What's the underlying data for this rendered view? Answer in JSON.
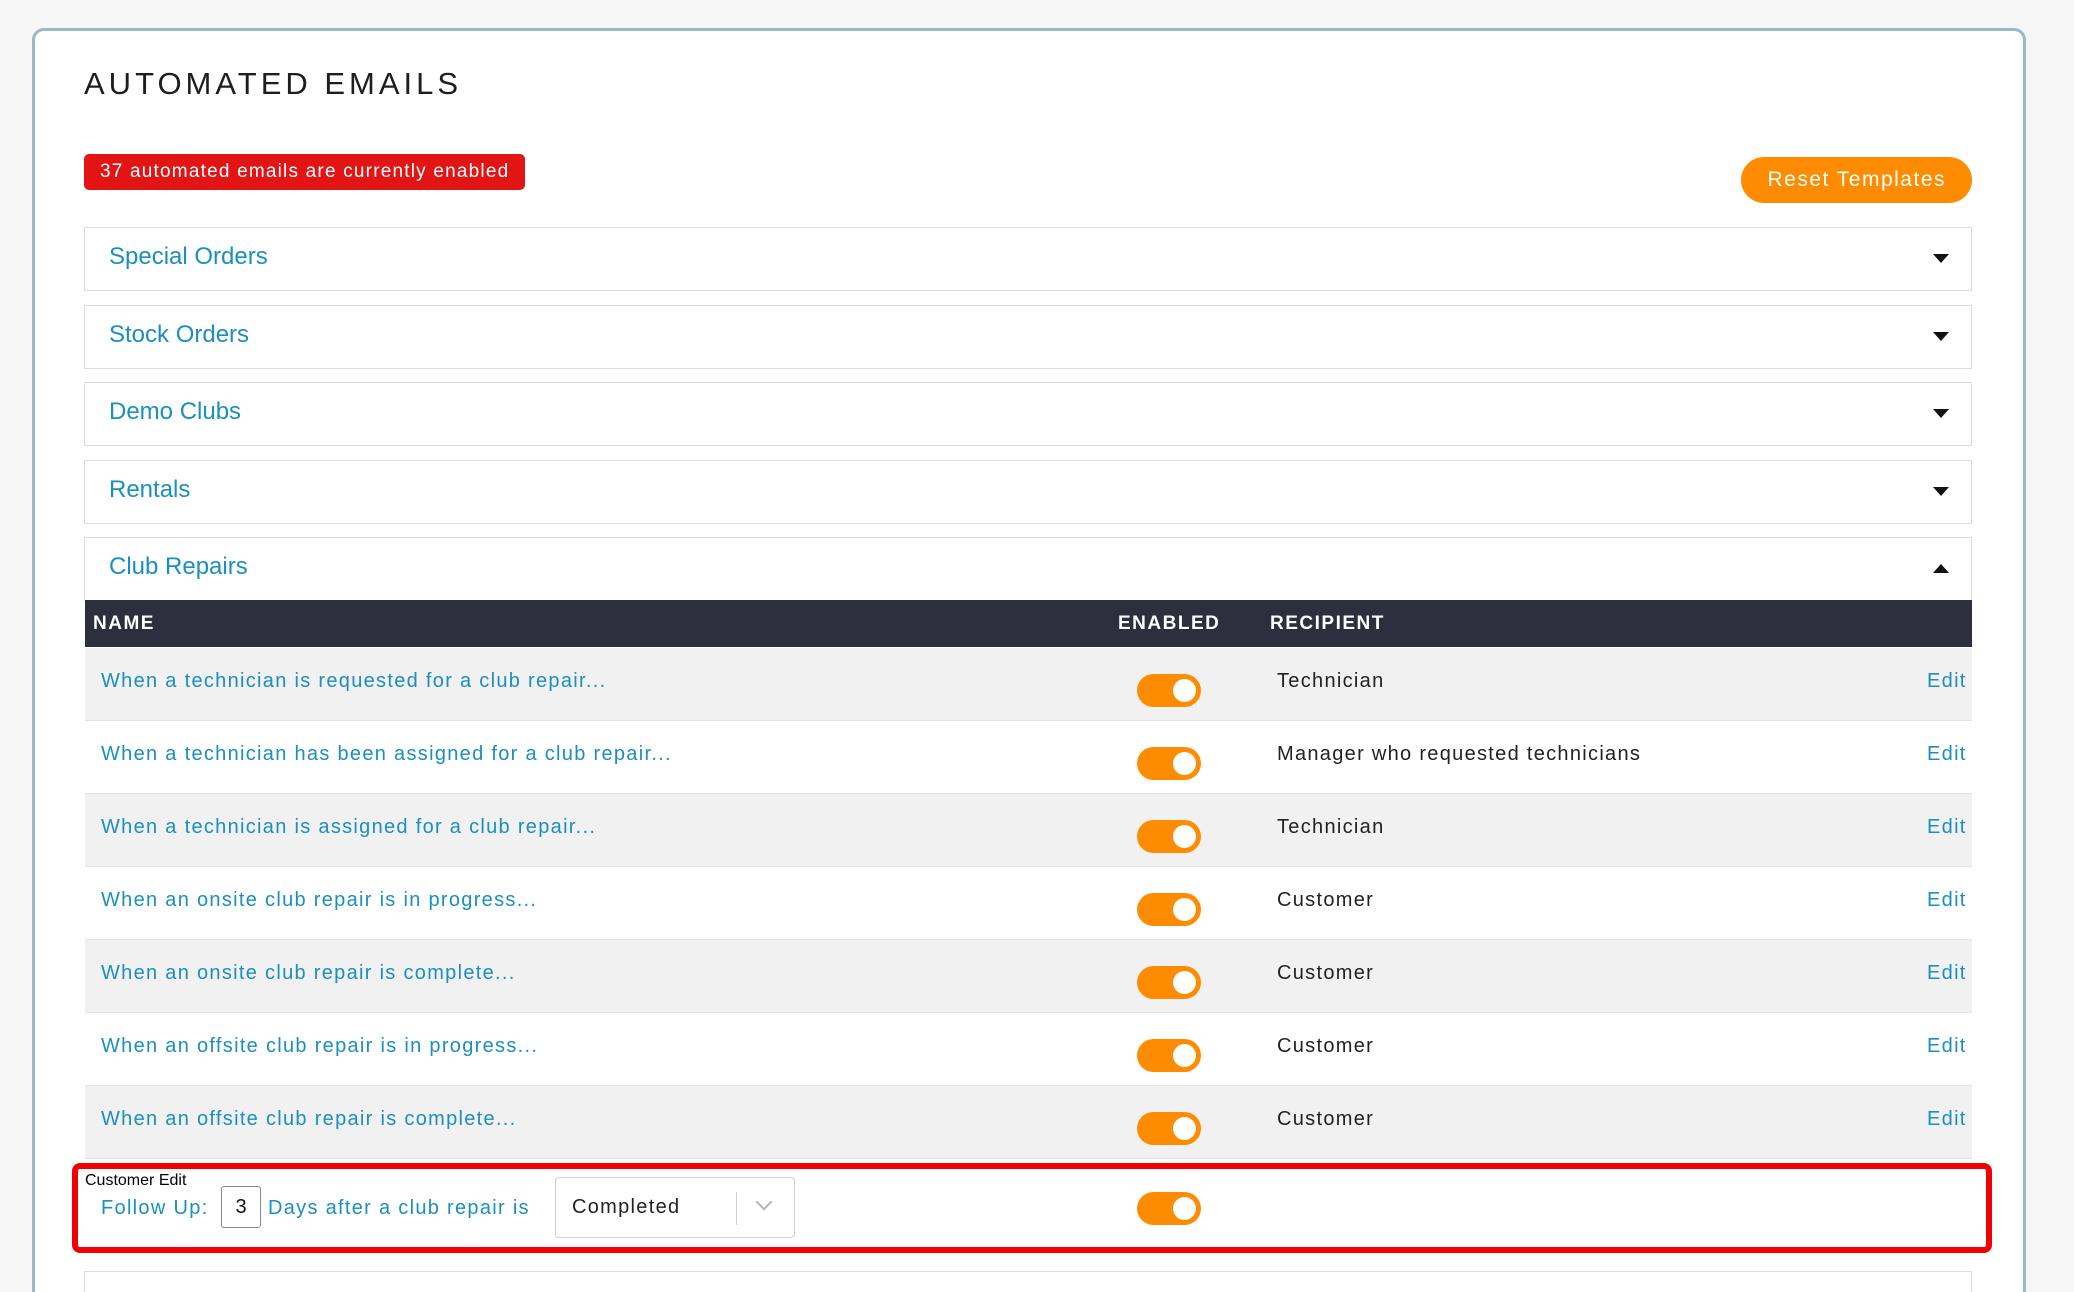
{
  "page": {
    "title": "AUTOMATED EMAILS",
    "enabled_count_text": "37 automated emails are currently enabled",
    "reset_button_label": "Reset Templates"
  },
  "sections": [
    {
      "label": "Special Orders",
      "expanded": false
    },
    {
      "label": "Stock Orders",
      "expanded": false
    },
    {
      "label": "Demo Clubs",
      "expanded": false
    },
    {
      "label": "Rentals",
      "expanded": false
    },
    {
      "label": "Club Repairs",
      "expanded": true
    }
  ],
  "table": {
    "headers": {
      "name": "NAME",
      "enabled": "ENABLED",
      "recipient": "RECIPIENT"
    },
    "rows": [
      {
        "name": "When a technician is requested for a club repair...",
        "enabled": true,
        "recipient": "Technician",
        "action": "Edit"
      },
      {
        "name": "When a technician has been assigned for a club repair...",
        "enabled": true,
        "recipient": "Manager who requested technicians",
        "action": "Edit"
      },
      {
        "name": "When a technician is assigned for a club repair...",
        "enabled": true,
        "recipient": "Technician",
        "action": "Edit"
      },
      {
        "name": "When an onsite club repair is in progress...",
        "enabled": true,
        "recipient": "Customer",
        "action": "Edit"
      },
      {
        "name": "When an onsite club repair is complete...",
        "enabled": true,
        "recipient": "Customer",
        "action": "Edit"
      },
      {
        "name": "When an offsite club repair is in progress...",
        "enabled": true,
        "recipient": "Customer",
        "action": "Edit"
      },
      {
        "name": "When an offsite club repair is complete...",
        "enabled": true,
        "recipient": "Customer",
        "action": "Edit"
      }
    ],
    "followup": {
      "label": "Follow Up:",
      "days": "3",
      "after_text": "Days after a club repair is",
      "status_value": "Completed",
      "enabled": true,
      "recipient": "Customer",
      "action": "Edit"
    }
  },
  "colors": {
    "accent": "#1b8ec2",
    "toggle_on": "#ff8c00",
    "badge": "#e31414",
    "header_bg": "#2e2f3e",
    "highlight": "#f20000"
  },
  "icons": {
    "collapsed": "caret-down-icon",
    "expanded": "caret-up-icon",
    "select": "chevron-down-icon"
  }
}
